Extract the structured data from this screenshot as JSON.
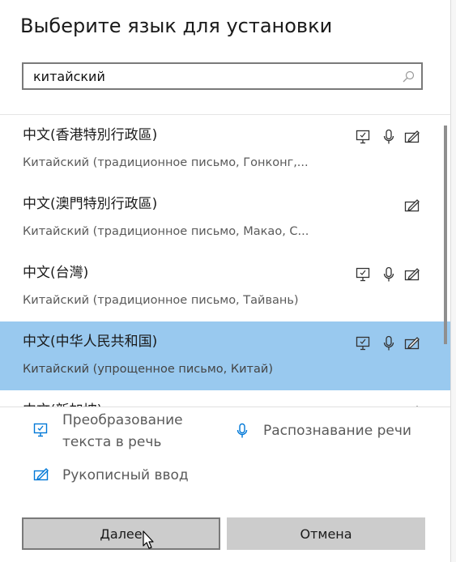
{
  "dialog": {
    "title": "Выберите язык для установки"
  },
  "search": {
    "value": "китайский"
  },
  "languages": [
    {
      "name": "中文(香港特別行政區)",
      "description": "Китайский (традиционное письмо, Гонконг,...",
      "features": [
        "tts",
        "speech",
        "handwriting"
      ],
      "selected": false
    },
    {
      "name": "中文(澳門特別行政區)",
      "description": "Китайский (традиционное письмо, Макао, С...",
      "features": [
        "handwriting"
      ],
      "selected": false
    },
    {
      "name": "中文(台灣)",
      "description": "Китайский (традиционное письмо, Тайвань)",
      "features": [
        "tts",
        "speech",
        "handwriting"
      ],
      "selected": false
    },
    {
      "name": "中文(中华人民共和国)",
      "description": "Китайский (упрощенное письмо, Китай)",
      "features": [
        "tts",
        "speech",
        "handwriting"
      ],
      "selected": true
    },
    {
      "name": "中文(新加坡)",
      "description": "",
      "features": [
        "handwriting"
      ],
      "selected": false
    }
  ],
  "legend": {
    "tts_label": "Преобразование текста в речь",
    "tts_line1": "Преобразование",
    "tts_line2": "текста в речь",
    "speech_label": "Распознавание речи",
    "handwriting_label": "Рукописный ввод"
  },
  "buttons": {
    "next": "Далее",
    "cancel": "Отмена"
  },
  "colors": {
    "selected_bg": "#99c9ef",
    "accent_icon": "#0078d7",
    "button_bg": "#cccccc"
  }
}
